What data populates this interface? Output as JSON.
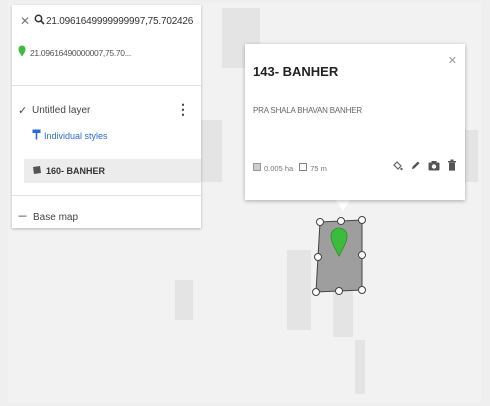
{
  "search": {
    "query": "21.0961649999999997,75.702426..."
  },
  "result": {
    "text": "21.09616490000007,75.70..."
  },
  "layers": {
    "layer_name": "Untitled layer",
    "styles_link": "Individual styles",
    "feature_label": "160- BANHER"
  },
  "basemap": {
    "label": "Base map"
  },
  "popup": {
    "title": "143- BANHER",
    "description": "PRA SHALA BHAVAN BANHER",
    "area": "0.005 ha",
    "perimeter": "75 m"
  },
  "colors": {
    "pin": "#3dbb3d",
    "polygon_fill": "#9e9e9e",
    "link": "#2a6bd4"
  },
  "icons": [
    "close-icon",
    "search-icon",
    "pin-icon",
    "checkbox-icon",
    "more-vert-icon",
    "style-icon",
    "polygon-icon",
    "base-map-icon",
    "area-icon",
    "perimeter-icon",
    "fill-color-icon",
    "edit-icon",
    "camera-icon",
    "delete-icon"
  ]
}
